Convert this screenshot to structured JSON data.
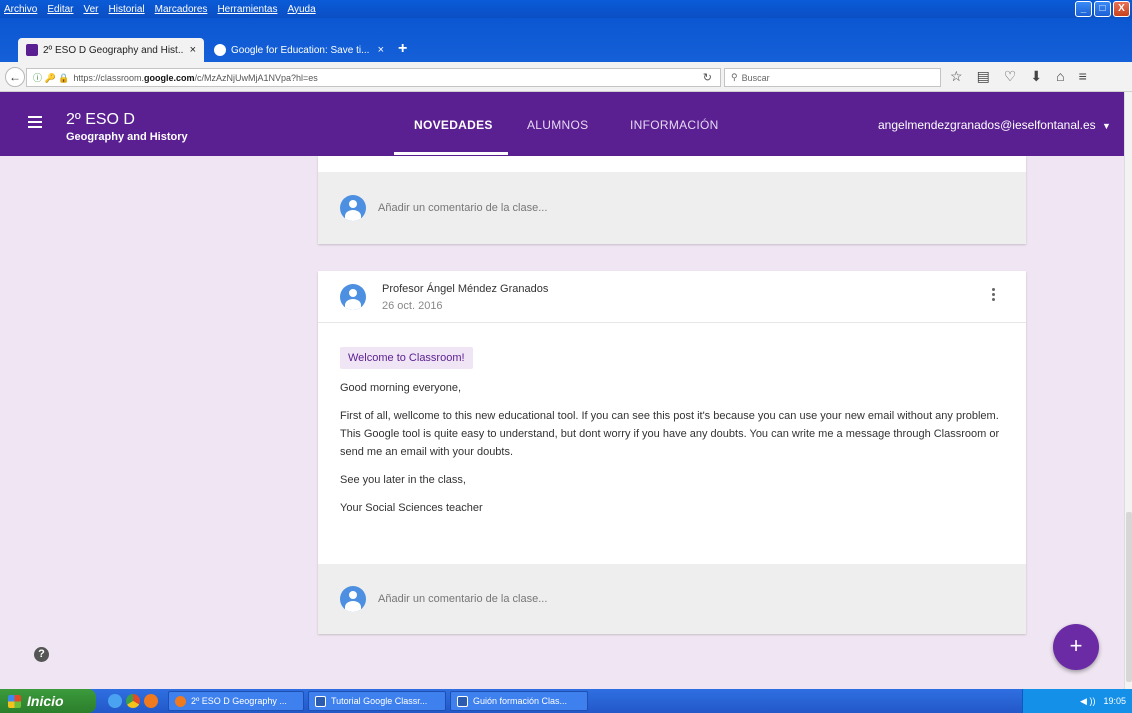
{
  "browser": {
    "menu": [
      "Archivo",
      "Editar",
      "Ver",
      "Historial",
      "Marcadores",
      "Herramientas",
      "Ayuda"
    ],
    "tabs": [
      {
        "title": "2º ESO D Geography and Hist...",
        "active": true
      },
      {
        "title": "Google for Education: Save ti...",
        "active": false
      }
    ],
    "new_tab": "+",
    "tab_close": "×",
    "url_prefix": "https://classroom.",
    "url_domain": "google.com",
    "url_suffix": "/c/MzAzNjUwMjA1NVpa?hl=es",
    "search_placeholder": "Buscar",
    "window_controls": [
      "_",
      "□",
      "X"
    ]
  },
  "classroom": {
    "class_name": "2º ESO D",
    "class_subject": "Geography and History",
    "tabs": [
      {
        "label": "NOVEDADES",
        "active": true
      },
      {
        "label": "ALUMNOS",
        "active": false
      },
      {
        "label": "INFORMACIÓN",
        "active": false
      }
    ],
    "account": "angelmendezgranados@ieselfontanal.es",
    "colors": {
      "header": "#5a1f91",
      "background": "#f0e6f3",
      "fab": "#6a2ba5"
    }
  },
  "stream": {
    "comment_placeholder": "Añadir un comentario de la clase...",
    "post": {
      "author": "Profesor Ángel Méndez Granados",
      "date": "26 oct. 2016",
      "title": "Welcome to Classroom!",
      "paragraphs": [
        "Good morning everyone,",
        "First of all, wellcome to this new educational tool. If you can see this post it's because you can use your new email without any problem. This Google tool is quite easy to understand, but dont worry if you have any doubts. You can write me a message through Classroom or send me an email with your doubts.",
        "See you later in the class,",
        "Your Social Sciences teacher"
      ]
    }
  },
  "fab_label": "+",
  "help_label": "?",
  "taskbar": {
    "start": "Inicio",
    "tasks": [
      "2º ESO D Geography ...",
      "Tutorial Google Classr...",
      "Guión formación Clas..."
    ],
    "clock": "19:05"
  }
}
